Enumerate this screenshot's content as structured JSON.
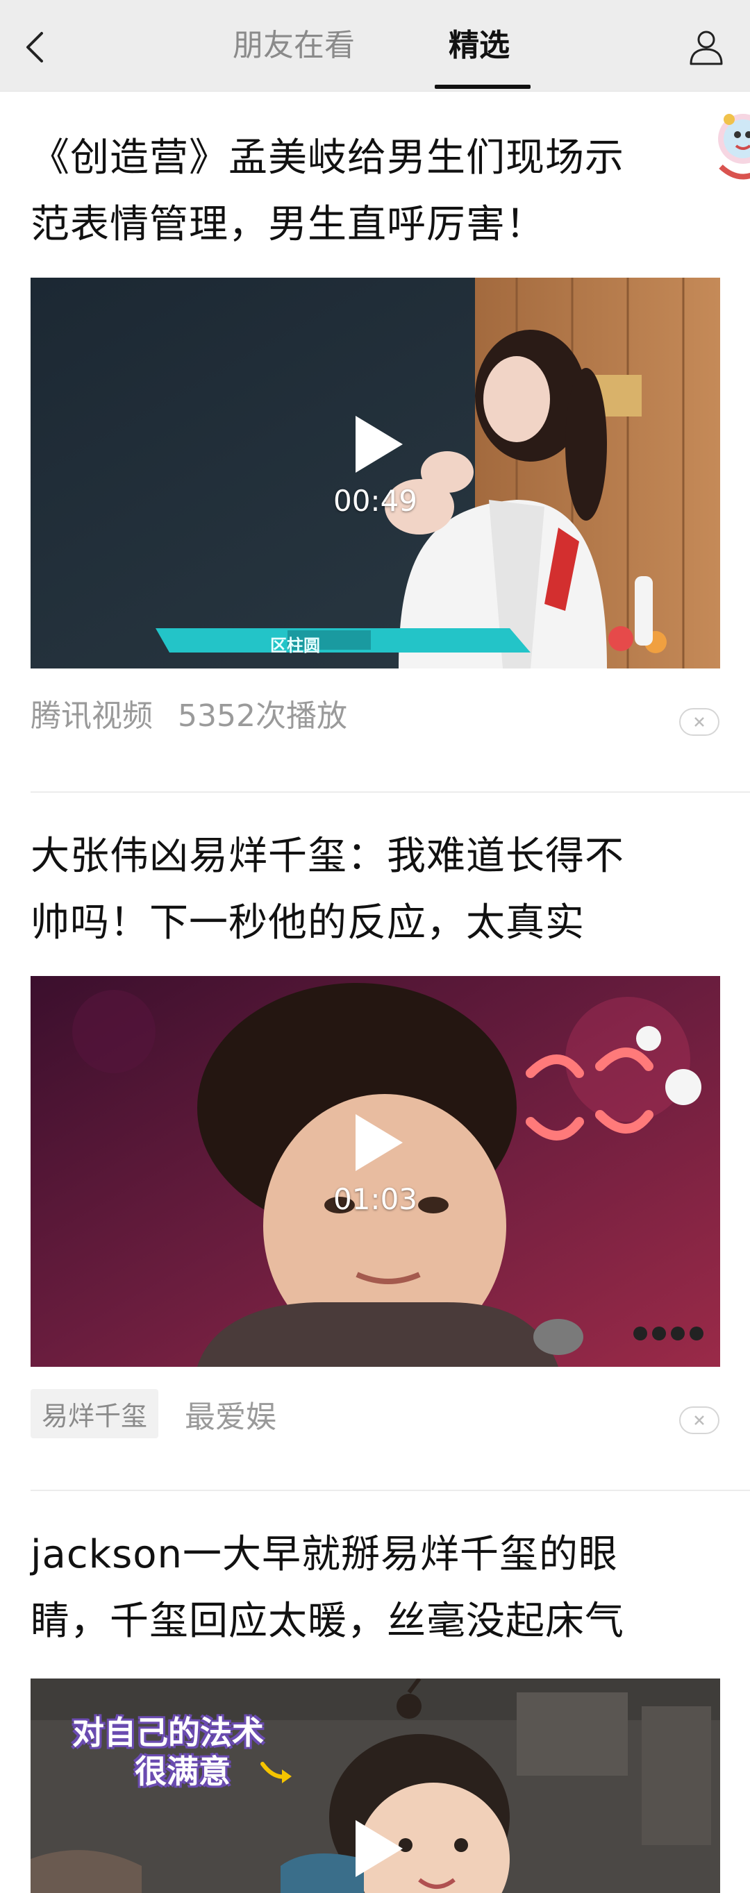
{
  "header": {
    "tabs": [
      {
        "label": "朋友在看",
        "active": false
      },
      {
        "label": "精选",
        "active": true
      }
    ],
    "icons": {
      "back": "chevron-left-icon",
      "profile": "person-icon"
    }
  },
  "cards": [
    {
      "title_line1": "《创造营》孟美岐给男生们现场示",
      "title_line2": "范表情管理，男生直呼厉害！",
      "duration": "00:49",
      "source": "腾讯视频",
      "views": "5352次播放",
      "thumbnail_caption": "区柱圆"
    },
    {
      "title_line1": "大张伟凶易烊千玺：我难道长得不",
      "title_line2": "帅吗！下一秒他的反应，太真实",
      "duration": "01:03",
      "tag": "易烊千玺",
      "source": "最爱娱"
    },
    {
      "title_line1": "jackson一大早就掰易烊千玺的眼",
      "title_line2": "睛，千玺回应太暖，丝毫没起床气",
      "thumbnail_caption_line1": "对自己的法术",
      "thumbnail_caption_line2": "很满意"
    }
  ],
  "colors": {
    "header_bg": "#ededed",
    "active_tab": "#111111",
    "inactive_tab": "#8a8a8a",
    "meta_text": "#9a9a9a"
  }
}
